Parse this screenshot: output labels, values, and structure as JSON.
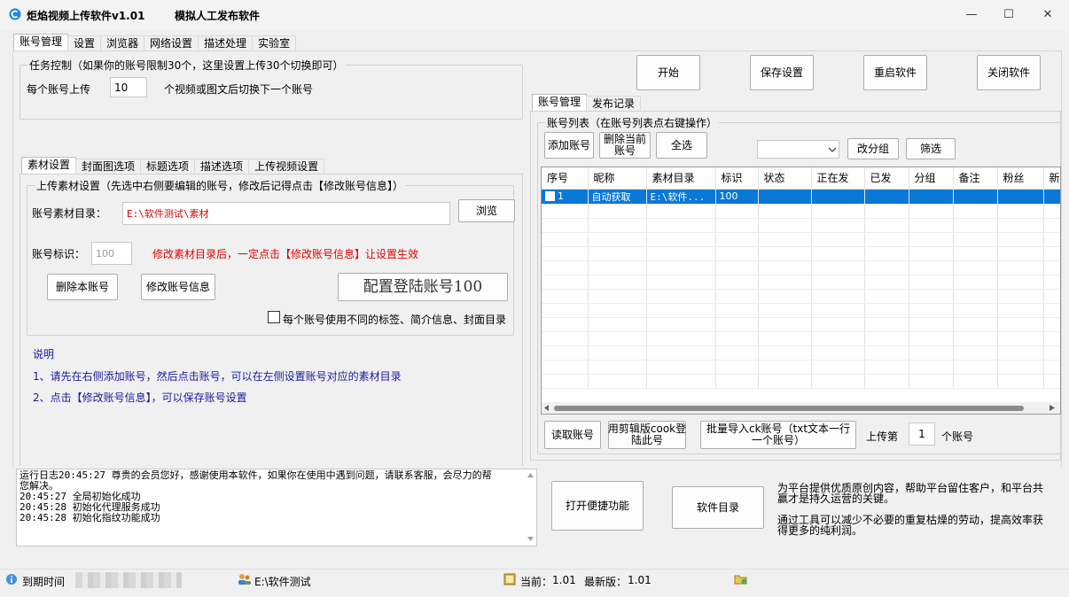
{
  "window": {
    "title": "炬焰视频上传软件v1.01",
    "subtitle": "模拟人工发布软件",
    "minimize": "—",
    "maximize": "☐",
    "close": "✕"
  },
  "main_tabs": [
    "账号管理",
    "设置",
    "浏览器",
    "网络设置",
    "描述处理",
    "实验室"
  ],
  "task_control": {
    "title": "任务控制（如果你的账号限制30个，这里设置上传30个切换即可）",
    "per_account_label": "每个账号上传",
    "per_account_value": "10",
    "suffix": "个视频或图文后切换下一个账号"
  },
  "toolbar": {
    "start": "开始",
    "save_settings": "保存设置",
    "restart": "重启软件",
    "close_app": "关闭软件"
  },
  "material_tabs": [
    "素材设置",
    "封面图选项",
    "标题选项",
    "描述选项",
    "上传视频设置"
  ],
  "upload_material": {
    "title": "上传素材设置（先选中右侧要编辑的账号，修改后记得点击【修改账号信息】）",
    "dir_label": "账号素材目录：",
    "dir_value": "E:\\软件测试\\素材",
    "browse": "浏览",
    "id_label": "账号标识：",
    "id_placeholder": "100",
    "warning": "修改素材目录后，一定点击【修改账号信息】让设置生效",
    "delete_account": "删除本账号",
    "modify_account": "修改账号信息",
    "config_login": "配置登陆账号100",
    "different_tags": "每个账号使用不同的标签、简介信息、封面目录"
  },
  "notes": {
    "title": "说明",
    "line1": "1、请先在右侧添加账号，然后点击账号，可以在左侧设置账号对应的素材目录",
    "line2": "2、点击【修改账号信息】，可以保存账号设置"
  },
  "right_tabs": [
    "账号管理",
    "发布记录"
  ],
  "account_list": {
    "title": "账号列表（在账号列表点右键操作）",
    "add": "添加账号",
    "delete_current": "删除当前\n账号",
    "select_all": "全选",
    "group_select_value": "",
    "change_group": "改分组",
    "filter": "筛选",
    "columns": [
      "序号",
      "昵称",
      "素材目录",
      "标识",
      "状态",
      "正在发",
      "已发",
      "分组",
      "备注",
      "粉丝",
      "新增"
    ],
    "rows": [
      {
        "no": "1",
        "nick": "自动获取",
        "dir": "E:\\软件...",
        "id": "100",
        "status": "",
        "sending": "",
        "sent": "",
        "group": "",
        "note": "",
        "fans": "",
        "new": ""
      }
    ]
  },
  "account_actions": {
    "read": "读取账号",
    "jianying_cookie": "用剪辑版cook登\n陆此号",
    "batch_import": "批量导入ck账号（txt文本一行\n一个账号）",
    "upload_nth_label": "上传第",
    "upload_nth_value": "1",
    "upload_nth_suffix": "个账号"
  },
  "log": {
    "lines": [
      "运行日志20:45:27 尊贵的会员您好，感谢使用本软件，如果你在使用中遇到问题，请联系客服，会尽力的帮",
      "您解决。",
      "20:45:27 全局初始化成功",
      "20:45:28 初始化代理服务成功",
      "20:45:28 初始化指纹功能成功"
    ]
  },
  "bottom": {
    "quick_functions": "打开便捷功能",
    "software_dir": "软件目录",
    "promo1": "为平台提供优质原创内容，帮助平台留住客户，和平台共赢才是持久运营的关键。",
    "promo2": "通过工具可以减少不必要的重复枯燥的劳动，提高效率获得更多的纯利润。"
  },
  "status": {
    "expire_label": "到期时间",
    "path": "E:\\软件测试",
    "current_label": "当前：",
    "current_value": "1.01",
    "latest_label": "最新版：",
    "latest_value": "1.01"
  },
  "colors": {
    "selection": "#0a78d7",
    "warning_red": "#e00000",
    "note_blue": "#1a1aa0",
    "dir_red": "#cc0000"
  }
}
